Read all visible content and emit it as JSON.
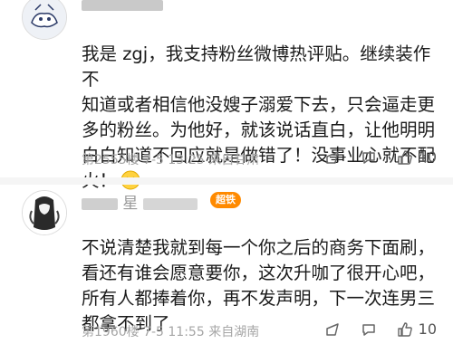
{
  "comments": [
    {
      "username": "",
      "text": "我是 zgj，我支持粉丝微博热评贴。继续装作不\n知道或者相信他没嫂子溺爱下去，只会逼走更\n多的粉丝。为他好，就该说话直白，让他明明\n白白知道不回应就是做错了！没事业心就不配\n火！",
      "meta": "第2555楼  7-5 13:25  来自甘肃",
      "likes": "10",
      "emoji": "smile-emoji"
    },
    {
      "username": "星",
      "badge": "超铁",
      "text": "不说清楚我就到每一个你之后的商务下面刷，\n看还有谁会愿意要你，这次升咖了很开心吧，\n所有人都捧着你，再不发声明，下一次连男三\n都拿不到了",
      "meta": "第1960楼  7-5 11:55  来自湖南",
      "likes": "10"
    }
  ],
  "colors": {
    "accent_badge": "#ff8a00",
    "meta_text": "#a6a6a6",
    "body_text": "#1b1b1b"
  }
}
